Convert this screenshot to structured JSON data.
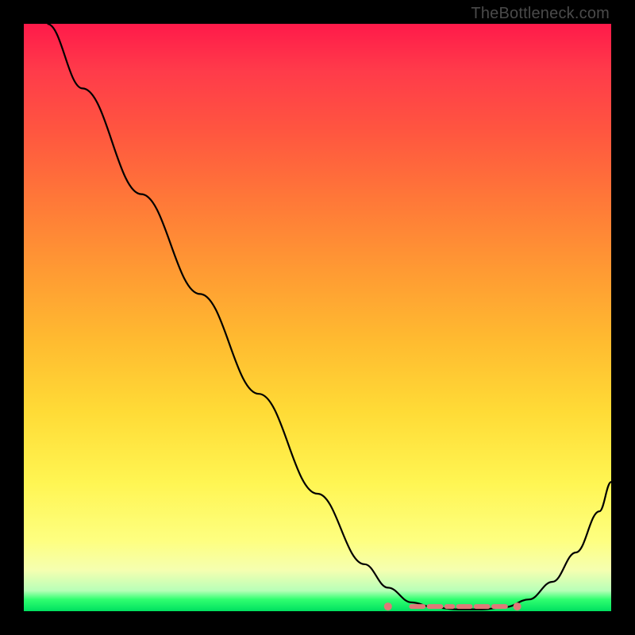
{
  "watermark": "TheBottleneck.com",
  "chart_data": {
    "type": "line",
    "title": "",
    "xlabel": "",
    "ylabel": "",
    "xlim": [
      0,
      100
    ],
    "ylim": [
      0,
      100
    ],
    "background_gradient": {
      "top": "#ff1a4a",
      "mid": "#fff552",
      "bottom": "#00e060"
    },
    "series": [
      {
        "name": "curve",
        "x": [
          4,
          10,
          20,
          30,
          40,
          50,
          58,
          62,
          66,
          70,
          74,
          78,
          82,
          86,
          90,
          94,
          98,
          100
        ],
        "y": [
          100,
          89,
          71,
          54,
          37,
          20,
          8,
          4,
          1.5,
          0.6,
          0.3,
          0.3,
          0.7,
          2.0,
          5.0,
          10,
          17,
          22
        ]
      }
    ],
    "markers": {
      "dots_x": [
        62,
        84
      ],
      "dash_segments": [
        [
          66,
          68
        ],
        [
          69,
          71
        ],
        [
          72,
          73
        ],
        [
          74,
          76
        ],
        [
          77,
          79
        ],
        [
          80,
          82
        ]
      ],
      "marker_y": 0.8
    }
  }
}
